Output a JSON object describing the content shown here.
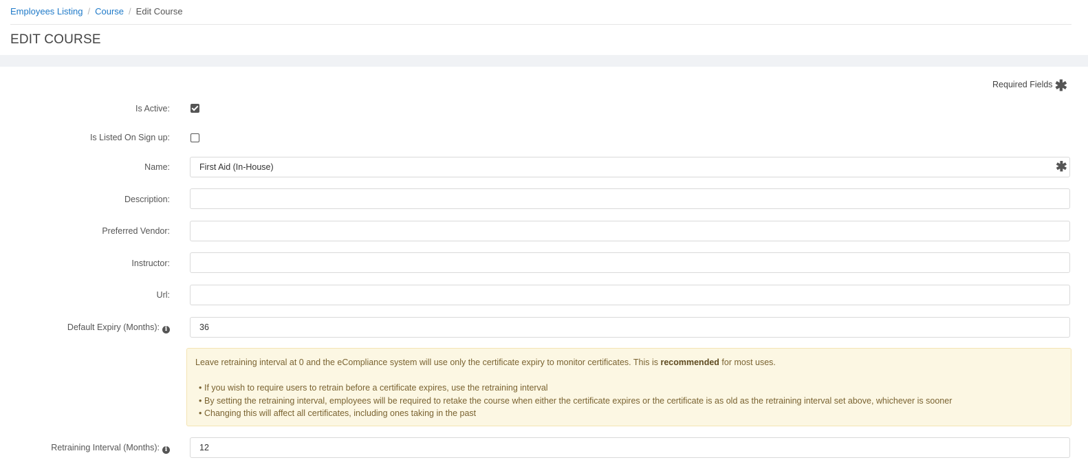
{
  "breadcrumb": {
    "items": [
      "Employees Listing",
      "Course"
    ],
    "separator": "/",
    "current": "Edit Course"
  },
  "page_title": "EDIT COURSE",
  "required_fields": {
    "label": "Required Fields",
    "marker": "✱"
  },
  "form": {
    "is_active": {
      "label": "Is Active:",
      "checked": true
    },
    "is_listed": {
      "label": "Is Listed On Sign up:",
      "checked": false
    },
    "name": {
      "label": "Name:",
      "value": "First Aid (In-House)",
      "required_marker": "✱"
    },
    "description": {
      "label": "Description:",
      "value": ""
    },
    "preferred_vendor": {
      "label": "Preferred Vendor:",
      "value": ""
    },
    "instructor": {
      "label": "Instructor:",
      "value": ""
    },
    "url": {
      "label": "Url:",
      "value": ""
    },
    "default_expiry": {
      "label": "Default Expiry (Months):",
      "value": "36"
    },
    "retraining_interval": {
      "label": "Retraining Interval (Months):",
      "value": "12"
    }
  },
  "info_icon_glyph": "i",
  "alert": {
    "intro_before": "Leave retraining interval at 0 and the eCompliance system will use only the certificate expiry to monitor certificates. This is ",
    "intro_bold": "recommended",
    "intro_after": " for most uses.",
    "bullets": [
      "If you wish to require users to retrain before a certificate expires, use the retraining interval",
      "By setting the retraining interval, employees will be required to retake the course when either the certificate expires or the certificate is as old as the retraining interval set above, whichever is sooner",
      "Changing this will affect all certificates, including ones taking in the past"
    ]
  },
  "colors": {
    "link": "#1e79c8",
    "page_background": "#f0f2f5",
    "alert_background": "#fcf7e3",
    "alert_text": "#7a6331"
  },
  "icons": [
    "required-star-icon",
    "info-icon",
    "checkbox-checked-icon"
  ]
}
